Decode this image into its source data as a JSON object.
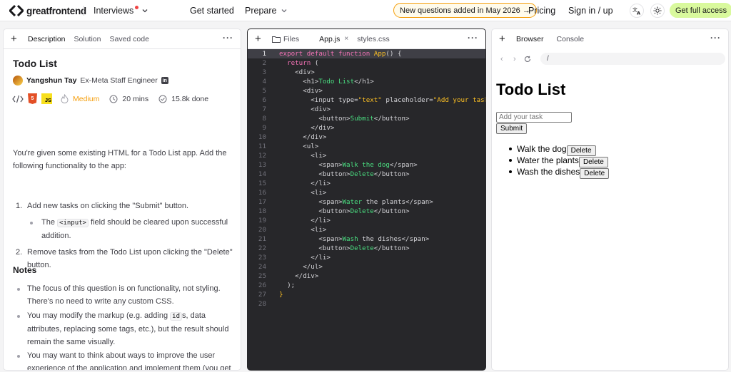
{
  "nav": {
    "logo_text": "greatfrontend",
    "interviews": "Interviews",
    "get_started": "Get started",
    "prepare": "Prepare",
    "banner": "New questions added in May 2026 →",
    "pricing": "Pricing",
    "sign_in": "Sign in / up",
    "cta": "Get full access"
  },
  "left_panel": {
    "tabs": [
      "Description",
      "Solution",
      "Saved code"
    ],
    "title": "Todo List",
    "author_name": "Yangshun Tay",
    "author_role": "Ex-Meta Staff Engineer",
    "badge_html": "5",
    "badge_js": "JS",
    "difficulty": "Medium",
    "duration": "20 mins",
    "completions": "15.8k done",
    "intro": "You're given some existing HTML for a Todo List app. Add the following functionality to the app:",
    "steps": [
      {
        "num": "1.",
        "text": "Add new tasks on clicking the \"Submit\" button."
      },
      {
        "num": "2.",
        "text": "Remove tasks from the Todo List upon clicking the \"Delete\" button."
      }
    ],
    "substep_prefix": "The",
    "substep_code": "<input>",
    "substep_suffix": "field should be cleared upon successful addition.",
    "notes_heading": "Notes",
    "notes": [
      "The focus of this question is on functionality, not styling. There's no need to write any custom CSS."
    ],
    "note2_prefix": "You may modify the markup (e.g. adding",
    "note2_code": "id",
    "note2_suffix": "s, data attributes, replacing some tags, etc.), but the result should remain the same visually.",
    "note3": "You may want to think about ways to improve the user experience of the application and implement them (you get bonus credit for doing that during interviews)."
  },
  "mid_panel": {
    "files_label": "Files",
    "tabs": [
      "App.js",
      "styles.css"
    ],
    "line_numbers": [
      "1",
      "2",
      "3",
      "4",
      "5",
      "6",
      "7",
      "8",
      "9",
      "10",
      "11",
      "12",
      "13",
      "14",
      "15",
      "16",
      "17",
      "18",
      "19",
      "20",
      "21",
      "22",
      "23",
      "24",
      "25",
      "26",
      "27",
      "28"
    ]
  },
  "right_panel": {
    "tabs": [
      "Browser",
      "Console"
    ],
    "url": "/",
    "heading": "Todo List",
    "input_placeholder": "Add your task",
    "submit": "Submit",
    "items": [
      "Walk the dog",
      "Water the plants",
      "Wash the dishes"
    ],
    "delete": "Delete"
  },
  "colors": {
    "accent_cta": "#d9f99d",
    "banner_border": "#f59e0b",
    "editor_bg": "#27272a",
    "keyword": "#f472b6",
    "string": "#fbbf24",
    "jsx_text": "#4ade80"
  }
}
